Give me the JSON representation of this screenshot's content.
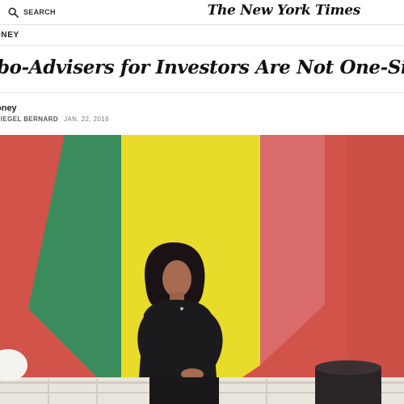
{
  "header": {
    "search_label": "SEARCH",
    "logo_text": "The New York Times"
  },
  "article": {
    "section_label": "ONEY",
    "headline": "bo-Advisers for Investors Are Not One-Size-Fits-All",
    "column_name": "oney",
    "byline": "SIEGEL BERNARD",
    "date": "JAN. 22, 2016"
  },
  "colors": {
    "wall_red": "#d45a4e",
    "stripe_green": "#3d8f5f",
    "stripe_yellow": "#eadd2a",
    "stripe_pink": "#d86a6a",
    "clothing": "#1b1a1c"
  },
  "icons": {
    "search": "search-icon"
  }
}
